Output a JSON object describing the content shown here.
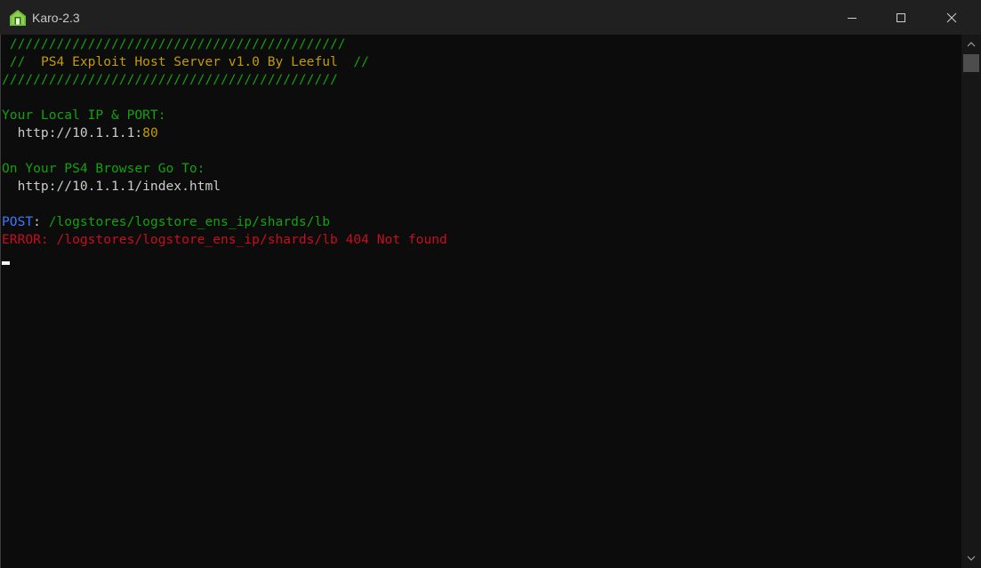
{
  "window": {
    "title": "Karo-2.3"
  },
  "terminal": {
    "lines": [
      {
        "segments": [
          {
            "text": " ///////////////////////////////////////////",
            "color": "green"
          }
        ]
      },
      {
        "segments": [
          {
            "text": " //  ",
            "color": "green"
          },
          {
            "text": "PS4 Exploit Host Server v1.0 By Leeful",
            "color": "yellow"
          },
          {
            "text": "  //",
            "color": "green"
          }
        ]
      },
      {
        "segments": [
          {
            "text": "///////////////////////////////////////////",
            "color": "green"
          }
        ]
      },
      {
        "segments": [
          {
            "text": "",
            "color": "white"
          }
        ]
      },
      {
        "segments": [
          {
            "text": "Your Local IP & PORT:",
            "color": "green"
          }
        ]
      },
      {
        "segments": [
          {
            "text": "  http://10.1.1.1:",
            "color": "white"
          },
          {
            "text": "80",
            "color": "yellow"
          }
        ]
      },
      {
        "segments": [
          {
            "text": "",
            "color": "white"
          }
        ]
      },
      {
        "segments": [
          {
            "text": "On Your PS4 Browser Go To:",
            "color": "green"
          }
        ]
      },
      {
        "segments": [
          {
            "text": "  http://10.1.1.1/index.html",
            "color": "white"
          }
        ]
      },
      {
        "segments": [
          {
            "text": "",
            "color": "white"
          }
        ]
      },
      {
        "segments": [
          {
            "text": "POST",
            "color": "blue"
          },
          {
            "text": ": ",
            "color": "white"
          },
          {
            "text": "/logstores/logstore_ens_ip/shards/lb",
            "color": "green"
          }
        ]
      },
      {
        "segments": [
          {
            "text": "ERROR: /logstores/logstore_ens_ip/shards/lb 404 Not found",
            "color": "red"
          }
        ]
      }
    ]
  },
  "colors": {
    "green": "#13a10e",
    "yellow": "#c19c00",
    "white": "#cccccc",
    "blue": "#3b78ff",
    "red": "#c50f1f",
    "background": "#0c0c0c",
    "titlebar": "#202020"
  },
  "icons": {
    "app": "app-house-icon",
    "minimize": "minimize-icon",
    "maximize": "maximize-icon",
    "close": "close-icon",
    "scroll_up": "scroll-up-arrow-icon",
    "scroll_down": "scroll-down-arrow-icon"
  }
}
